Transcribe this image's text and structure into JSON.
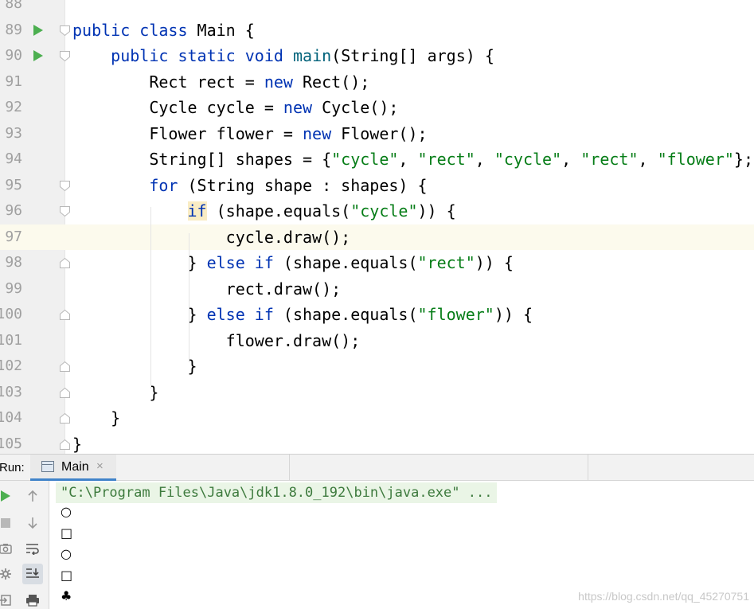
{
  "editor": {
    "current_line": "97",
    "lines": [
      {
        "num": "88",
        "code": ""
      },
      {
        "num": "89",
        "code": "public class Main {"
      },
      {
        "num": "90",
        "code": "    public static void main(String[] args) {"
      },
      {
        "num": "91",
        "code": "        Rect rect = new Rect();"
      },
      {
        "num": "92",
        "code": "        Cycle cycle = new Cycle();"
      },
      {
        "num": "93",
        "code": "        Flower flower = new Flower();"
      },
      {
        "num": "94",
        "code": "        String[] shapes = {\"cycle\", \"rect\", \"cycle\", \"rect\", \"flower\"};"
      },
      {
        "num": "95",
        "code": "        for (String shape : shapes) {"
      },
      {
        "num": "96",
        "code": "            if (shape.equals(\"cycle\")) {"
      },
      {
        "num": "97",
        "code": "                cycle.draw();"
      },
      {
        "num": "98",
        "code": "            } else if (shape.equals(\"rect\")) {"
      },
      {
        "num": "99",
        "code": "                rect.draw();"
      },
      {
        "num": "100",
        "code": "            } else if (shape.equals(\"flower\")) {"
      },
      {
        "num": "101",
        "code": "                flower.draw();"
      },
      {
        "num": "102",
        "code": "            }"
      },
      {
        "num": "103",
        "code": "        }"
      },
      {
        "num": "104",
        "code": "    }"
      },
      {
        "num": "105",
        "code": "}"
      }
    ],
    "run_markers": [
      "89",
      "90"
    ],
    "fold_markers": {
      "89": "open",
      "90": "open",
      "95": "open",
      "96": "open",
      "98": "close",
      "100": "close",
      "102": "close",
      "103": "close",
      "104": "close",
      "105": "close"
    }
  },
  "run_panel": {
    "label": "Run:",
    "tab_label": "Main",
    "tab_close": "×",
    "toolbar_icons": [
      "rerun-icon",
      "up-icon",
      "stop-icon",
      "down-icon",
      "camera-icon",
      "soft-wrap-icon",
      "settings-icon",
      "scroll-to-end-icon",
      "exit-icon",
      "print-icon"
    ],
    "command": "\"C:\\Program Files\\Java\\jdk1.8.0_192\\bin\\java.exe\" ...",
    "output": [
      "○",
      "□",
      "○",
      "□",
      "♣"
    ]
  },
  "watermark": "https://blog.csdn.net/qq_45270751",
  "colors": {
    "keyword": "#0033b3",
    "string": "#067d17",
    "run_marker": "#4caf50",
    "tab_underline": "#4083c9",
    "current_line": "#fcfaed"
  }
}
